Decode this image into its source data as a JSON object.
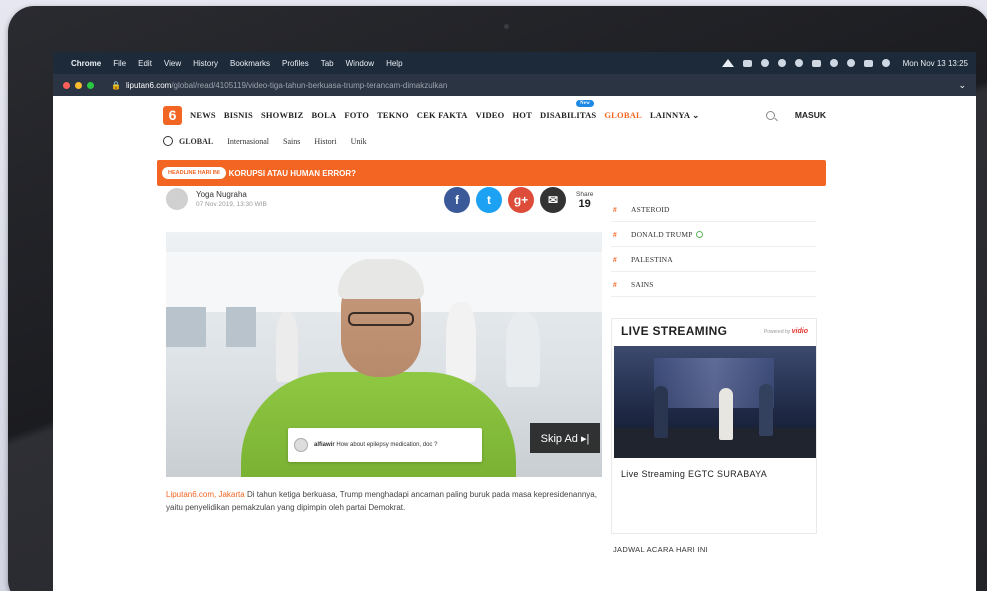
{
  "menubar": {
    "items": [
      "Chrome",
      "File",
      "Edit",
      "View",
      "History",
      "Bookmarks",
      "Profiles",
      "Tab",
      "Window",
      "Help"
    ],
    "clock": "Mon Nov 13  13:25"
  },
  "browser": {
    "url_host": "liputan6.com",
    "url_path": "/global/read/4105119/video-tiga-tahun-berkuasa-trump-terancam-dimakzulkan"
  },
  "site": {
    "logo": "6",
    "nav": [
      "NEWS",
      "BISNIS",
      "SHOWBIZ",
      "BOLA",
      "FOTO",
      "TEKNO",
      "CEK FAKTA",
      "VIDEO",
      "HOT",
      "DISABILITAS",
      "GLOBAL",
      "LAINNYA ⌄"
    ],
    "new_badge": "New",
    "login": "MASUK",
    "subnav": [
      "GLOBAL",
      "Internasional",
      "Sains",
      "Histori",
      "Unik"
    ],
    "headline_badge": "HEADLINE HARI INI",
    "headline_text": "KORUPSI ATAU HUMAN ERROR?"
  },
  "article": {
    "author": "Yoga Nugraha",
    "date": "07 Nov 2019, 13:30 WIB",
    "share_label": "Share",
    "share_count": "19",
    "lead_source": "Liputan6.com, Jakarta",
    "lead_text": " Di tahun ketiga berkuasa, Trump menghadapi ancaman paling buruk pada masa kepresidenannya, yaitu penyelidikan pemakzulan yang dipimpin oleh partai Demokrat."
  },
  "video": {
    "skip_ad": "Skip Ad ▸|",
    "comment_user": "alfiawir",
    "comment_text": " How about epilepsy medication, doc ?"
  },
  "sidebar": {
    "trending": [
      "ASTEROID",
      "DONALD TRUMP",
      "PALESTINA",
      "SAINS"
    ],
    "live_title": "LIVE STREAMING",
    "powered_by": "Powered by",
    "vidio": "vidio",
    "live_caption": "Live Streaming EGTC SURABAYA",
    "schedule": "JADWAL ACARA HARI INI"
  },
  "colors": {
    "brand": "#f26522",
    "facebook": "#3b5998",
    "twitter": "#1da1f2",
    "googleplus": "#dd4b39"
  }
}
